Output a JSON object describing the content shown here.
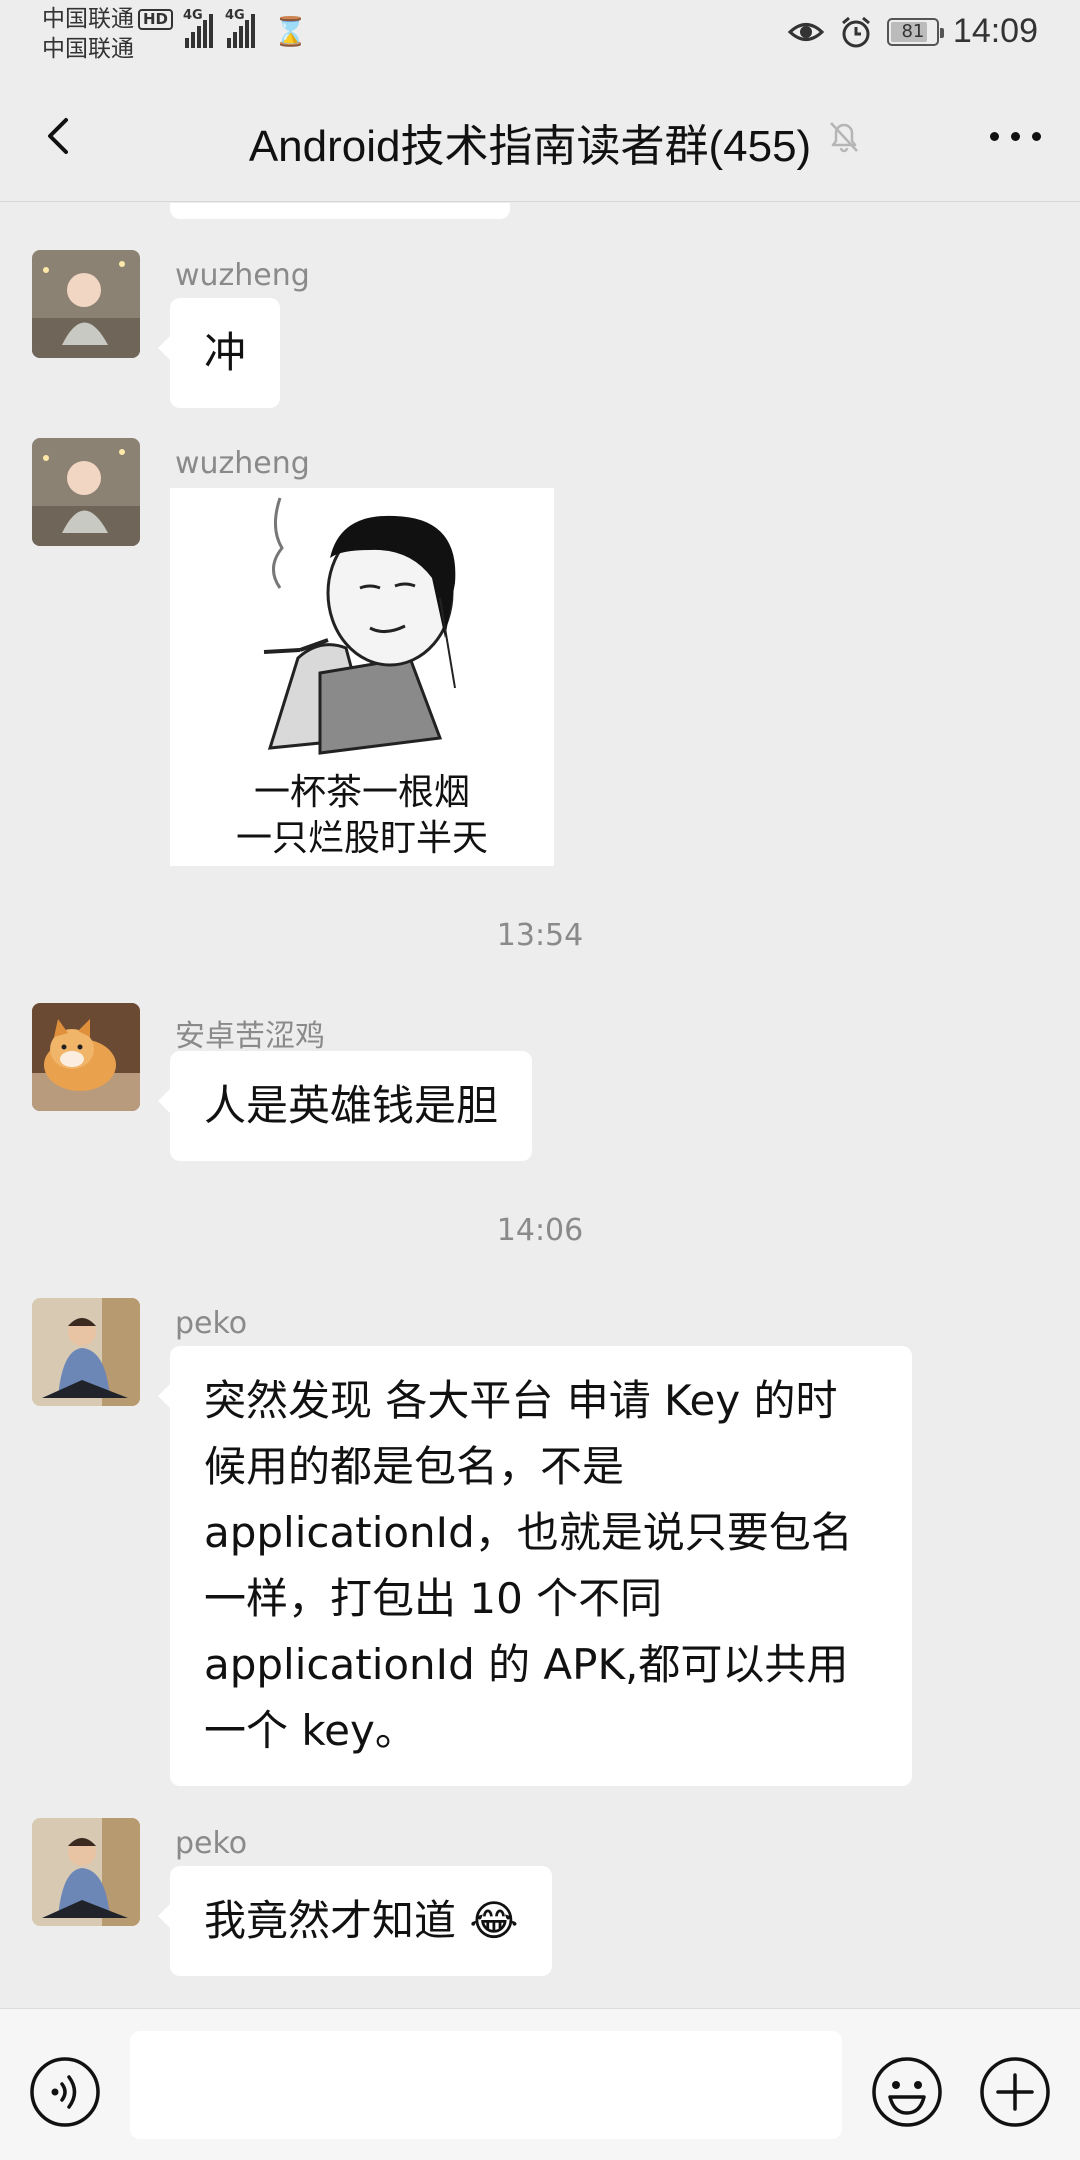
{
  "status_bar": {
    "carrier_1": "中国联通",
    "carrier_1_badge": "HD",
    "carrier_2": "中国联通",
    "network_1": "4G",
    "network_2": "4G",
    "battery": "81",
    "time": "14:09"
  },
  "header": {
    "title": "Android技术指南读者群(455)"
  },
  "messages": [
    {
      "sender": "wuzheng",
      "text": "冲"
    },
    {
      "sender": "wuzheng",
      "sticker_caption_line1": "一杯茶一根烟",
      "sticker_caption_line2": "一只烂股盯半天"
    },
    {
      "sender": "安卓苦涩鸡",
      "text": "人是英雄钱是胆"
    },
    {
      "sender": "peko",
      "text": "突然发现 各大平台 申请 Key 的时候用的都是包名，不是 applicationId，也就是说只要包名一样，打包出 10 个不同 applicationId 的 APK,都可以共用一个 key。"
    },
    {
      "sender": "peko",
      "text": "我竟然才知道 😂"
    }
  ],
  "timestamps": [
    "13:54",
    "14:06"
  ],
  "input": {
    "value": "",
    "placeholder": ""
  },
  "colors": {
    "background": "#ededed",
    "bubble": "#ffffff",
    "meta_text": "#8a8a8a"
  }
}
